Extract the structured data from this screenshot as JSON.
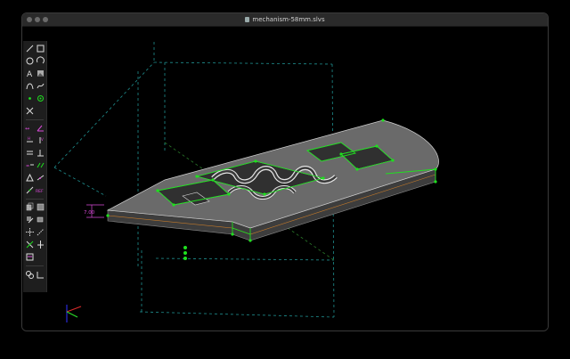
{
  "window": {
    "title": "mechanism-58mm.slvs"
  },
  "viewport": {
    "dimension_label": "7.00"
  },
  "toolbar": {
    "tools": [
      {
        "name": "line-tool-icon"
      },
      {
        "name": "rectangle-tool-icon"
      },
      {
        "name": "circle-tool-icon"
      },
      {
        "name": "arc-tool-icon"
      },
      {
        "name": "text-tool-icon"
      },
      {
        "name": "image-tool-icon"
      },
      {
        "name": "bezier-tool-icon"
      },
      {
        "name": "spline-tool-icon"
      },
      {
        "name": "point-tool-icon"
      },
      {
        "name": "tangent-arc-tool-icon"
      },
      {
        "name": "split-curves-tool-icon"
      },
      {
        "name": "dimension-distance-icon"
      },
      {
        "name": "dimension-angle-icon"
      },
      {
        "name": "horizontal-constraint-icon"
      },
      {
        "name": "vertical-constraint-icon"
      },
      {
        "name": "parallel-constraint-icon"
      },
      {
        "name": "perpendicular-constraint-icon"
      },
      {
        "name": "point-on-constraint-icon"
      },
      {
        "name": "equal-constraint-icon"
      },
      {
        "name": "symmetric-constraint-icon"
      },
      {
        "name": "same-orientation-icon"
      },
      {
        "name": "ref-constraint-icon"
      },
      {
        "name": "extrude-icon"
      },
      {
        "name": "lathe-icon"
      },
      {
        "name": "helix-icon"
      },
      {
        "name": "revolve-icon"
      },
      {
        "name": "step-translate-icon"
      },
      {
        "name": "step-rotate-icon"
      },
      {
        "name": "import-icon"
      },
      {
        "name": "workplane-icon"
      },
      {
        "name": "new-group-icon"
      },
      {
        "name": "sketch-in-3d-icon"
      }
    ],
    "ref_label": "REF"
  },
  "colors": {
    "background": "#000000",
    "toolbar": "#1e1e1e",
    "accent_magenta": "#d84ad8",
    "constraint_green": "#1fe01f",
    "workplane_cyan": "#1f9f9f",
    "solid_gray": "#6b6b6b"
  }
}
